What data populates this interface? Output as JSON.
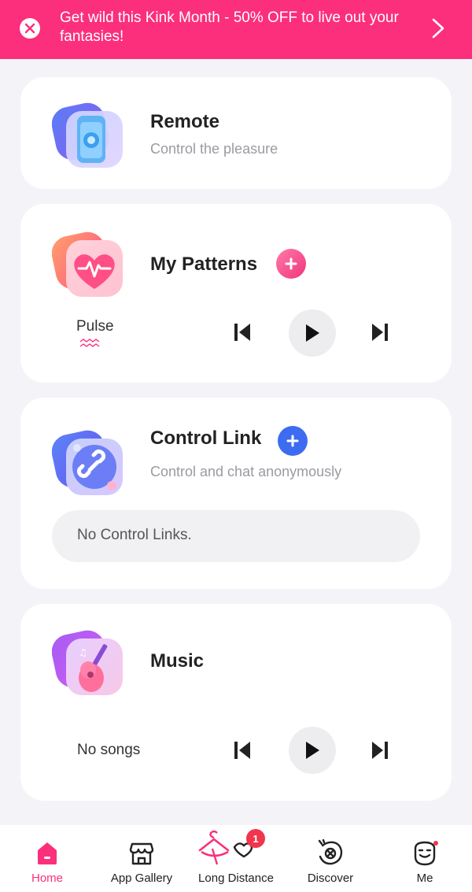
{
  "promo": {
    "text": "Get wild this Kink Month - 50% OFF to live out your fantasies!"
  },
  "cards": {
    "remote": {
      "title": "Remote",
      "subtitle": "Control the pleasure"
    },
    "patterns": {
      "title": "My Patterns",
      "current_pattern": "Pulse"
    },
    "control_link": {
      "title": "Control Link",
      "subtitle": "Control and chat anonymously",
      "empty_text": "No Control Links."
    },
    "music": {
      "title": "Music",
      "empty_text": "No songs"
    }
  },
  "nav": {
    "items": [
      {
        "label": "Home",
        "icon": "home-icon",
        "active": true
      },
      {
        "label": "App Gallery",
        "icon": "store-icon"
      },
      {
        "label": "Long Distance",
        "icon": "long-distance-icon",
        "badge": "1"
      },
      {
        "label": "Discover",
        "icon": "discover-icon"
      },
      {
        "label": "Me",
        "icon": "me-icon"
      }
    ]
  },
  "colors": {
    "accent": "#fb2f7c",
    "blue": "#3d6cf0"
  }
}
